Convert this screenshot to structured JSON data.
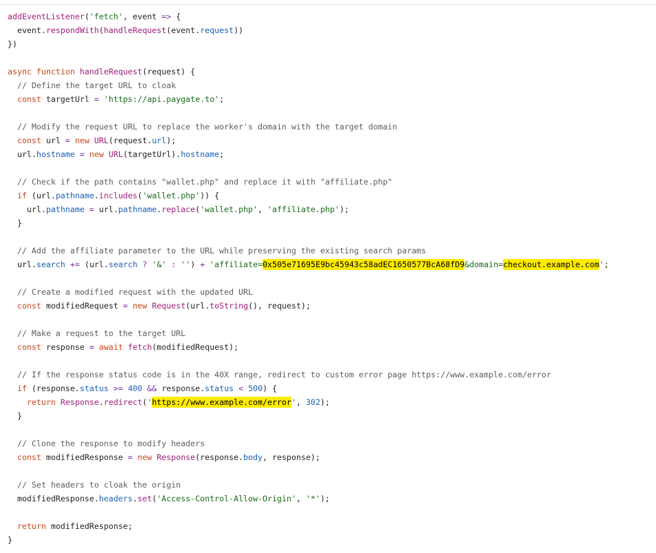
{
  "code_lines": [
    [
      {
        "t": "addEventListener",
        "c": "fn"
      },
      {
        "t": "("
      },
      {
        "t": "'fetch'",
        "c": "str"
      },
      {
        "t": ", event "
      },
      {
        "t": "=>",
        "c": "op"
      },
      {
        "t": " {"
      }
    ],
    [
      {
        "t": "  event."
      },
      {
        "t": "respondWith",
        "c": "fn"
      },
      {
        "t": "("
      },
      {
        "t": "handleRequest",
        "c": "fn"
      },
      {
        "t": "(event."
      },
      {
        "t": "request",
        "c": "prop"
      },
      {
        "t": "))"
      }
    ],
    [
      {
        "t": "})"
      }
    ],
    [],
    [
      {
        "t": "async ",
        "c": "kw"
      },
      {
        "t": "function ",
        "c": "kw"
      },
      {
        "t": "handleRequest",
        "c": "fn"
      },
      {
        "t": "(request) {"
      }
    ],
    [
      {
        "t": "  "
      },
      {
        "t": "// Define the target URL to cloak",
        "c": "cm"
      }
    ],
    [
      {
        "t": "  "
      },
      {
        "t": "const ",
        "c": "kw"
      },
      {
        "t": "targetUrl "
      },
      {
        "t": "=",
        "c": "op"
      },
      {
        "t": " "
      },
      {
        "t": "'https://api.paygate.to'",
        "c": "str"
      },
      {
        "t": ";"
      }
    ],
    [],
    [
      {
        "t": "  "
      },
      {
        "t": "// Modify the request URL to replace the worker's domain with the target domain",
        "c": "cm"
      }
    ],
    [
      {
        "t": "  "
      },
      {
        "t": "const ",
        "c": "kw"
      },
      {
        "t": "url "
      },
      {
        "t": "=",
        "c": "op"
      },
      {
        "t": " "
      },
      {
        "t": "new ",
        "c": "kw"
      },
      {
        "t": "URL",
        "c": "fn"
      },
      {
        "t": "(request."
      },
      {
        "t": "url",
        "c": "prop"
      },
      {
        "t": ");"
      }
    ],
    [
      {
        "t": "  url."
      },
      {
        "t": "hostname",
        "c": "prop"
      },
      {
        "t": " "
      },
      {
        "t": "=",
        "c": "op"
      },
      {
        "t": " "
      },
      {
        "t": "new ",
        "c": "kw"
      },
      {
        "t": "URL",
        "c": "fn"
      },
      {
        "t": "(targetUrl)."
      },
      {
        "t": "hostname",
        "c": "prop"
      },
      {
        "t": ";"
      }
    ],
    [],
    [
      {
        "t": "  "
      },
      {
        "t": "// Check if the path contains \"wallet.php\" and replace it with \"affiliate.php\"",
        "c": "cm"
      }
    ],
    [
      {
        "t": "  "
      },
      {
        "t": "if ",
        "c": "kw"
      },
      {
        "t": "(url."
      },
      {
        "t": "pathname",
        "c": "prop"
      },
      {
        "t": "."
      },
      {
        "t": "includes",
        "c": "fn"
      },
      {
        "t": "("
      },
      {
        "t": "'wallet.php'",
        "c": "str"
      },
      {
        "t": ")) {"
      }
    ],
    [
      {
        "t": "    url."
      },
      {
        "t": "pathname",
        "c": "prop"
      },
      {
        "t": " "
      },
      {
        "t": "=",
        "c": "op"
      },
      {
        "t": " url."
      },
      {
        "t": "pathname",
        "c": "prop"
      },
      {
        "t": "."
      },
      {
        "t": "replace",
        "c": "fn"
      },
      {
        "t": "("
      },
      {
        "t": "'wallet.php'",
        "c": "str"
      },
      {
        "t": ", "
      },
      {
        "t": "'affiliate.php'",
        "c": "str"
      },
      {
        "t": ");"
      }
    ],
    [
      {
        "t": "  }"
      }
    ],
    [],
    [
      {
        "t": "  "
      },
      {
        "t": "// Add the affiliate parameter to the URL while preserving the existing search params",
        "c": "cm"
      }
    ],
    [
      {
        "t": "  url."
      },
      {
        "t": "search",
        "c": "prop"
      },
      {
        "t": " "
      },
      {
        "t": "+=",
        "c": "op"
      },
      {
        "t": " (url."
      },
      {
        "t": "search",
        "c": "prop"
      },
      {
        "t": " "
      },
      {
        "t": "?",
        "c": "op"
      },
      {
        "t": " "
      },
      {
        "t": "'&'",
        "c": "str"
      },
      {
        "t": " "
      },
      {
        "t": ":",
        "c": "op"
      },
      {
        "t": " "
      },
      {
        "t": "''",
        "c": "str"
      },
      {
        "t": ") "
      },
      {
        "t": "+",
        "c": "op"
      },
      {
        "t": " "
      },
      {
        "t": "'affiliate=",
        "c": "str"
      },
      {
        "t": "0x505e71695E9bc45943c58adEC1650577BcA68fD9",
        "c": "hl"
      },
      {
        "t": "&domain=",
        "c": "str"
      },
      {
        "t": "checkout.example.com",
        "c": "hl"
      },
      {
        "t": "'",
        "c": "str"
      },
      {
        "t": ";"
      }
    ],
    [],
    [
      {
        "t": "  "
      },
      {
        "t": "// Create a modified request with the updated URL",
        "c": "cm"
      }
    ],
    [
      {
        "t": "  "
      },
      {
        "t": "const ",
        "c": "kw"
      },
      {
        "t": "modifiedRequest "
      },
      {
        "t": "=",
        "c": "op"
      },
      {
        "t": " "
      },
      {
        "t": "new ",
        "c": "kw"
      },
      {
        "t": "Request",
        "c": "fn"
      },
      {
        "t": "(url."
      },
      {
        "t": "toString",
        "c": "fn"
      },
      {
        "t": "(), request);"
      }
    ],
    [],
    [
      {
        "t": "  "
      },
      {
        "t": "// Make a request to the target URL",
        "c": "cm"
      }
    ],
    [
      {
        "t": "  "
      },
      {
        "t": "const ",
        "c": "kw"
      },
      {
        "t": "response "
      },
      {
        "t": "=",
        "c": "op"
      },
      {
        "t": " "
      },
      {
        "t": "await ",
        "c": "kw"
      },
      {
        "t": "fetch",
        "c": "fn"
      },
      {
        "t": "(modifiedRequest);"
      }
    ],
    [],
    [
      {
        "t": "  "
      },
      {
        "t": "// If the response status code is in the 40X range, redirect to custom error page https://www.example.com/error",
        "c": "cm"
      }
    ],
    [
      {
        "t": "  "
      },
      {
        "t": "if ",
        "c": "kw"
      },
      {
        "t": "(response."
      },
      {
        "t": "status",
        "c": "prop"
      },
      {
        "t": " "
      },
      {
        "t": ">=",
        "c": "op"
      },
      {
        "t": " "
      },
      {
        "t": "400",
        "c": "num"
      },
      {
        "t": " "
      },
      {
        "t": "&&",
        "c": "op"
      },
      {
        "t": " response."
      },
      {
        "t": "status",
        "c": "prop"
      },
      {
        "t": " "
      },
      {
        "t": "<",
        "c": "op"
      },
      {
        "t": " "
      },
      {
        "t": "500",
        "c": "num"
      },
      {
        "t": ") {"
      }
    ],
    [
      {
        "t": "    "
      },
      {
        "t": "return ",
        "c": "kw"
      },
      {
        "t": "Response",
        "c": "fn"
      },
      {
        "t": "."
      },
      {
        "t": "redirect",
        "c": "fn"
      },
      {
        "t": "("
      },
      {
        "t": "'",
        "c": "str"
      },
      {
        "t": "https://www.example.com/error",
        "c": "hl"
      },
      {
        "t": "'",
        "c": "str"
      },
      {
        "t": ", "
      },
      {
        "t": "302",
        "c": "num"
      },
      {
        "t": ");"
      }
    ],
    [
      {
        "t": "  }"
      }
    ],
    [],
    [
      {
        "t": "  "
      },
      {
        "t": "// Clone the response to modify headers",
        "c": "cm"
      }
    ],
    [
      {
        "t": "  "
      },
      {
        "t": "const ",
        "c": "kw"
      },
      {
        "t": "modifiedResponse "
      },
      {
        "t": "=",
        "c": "op"
      },
      {
        "t": " "
      },
      {
        "t": "new ",
        "c": "kw"
      },
      {
        "t": "Response",
        "c": "fn"
      },
      {
        "t": "(response."
      },
      {
        "t": "body",
        "c": "prop"
      },
      {
        "t": ", response);"
      }
    ],
    [],
    [
      {
        "t": "  "
      },
      {
        "t": "// Set headers to cloak the origin",
        "c": "cm"
      }
    ],
    [
      {
        "t": "  modifiedResponse."
      },
      {
        "t": "headers",
        "c": "prop"
      },
      {
        "t": "."
      },
      {
        "t": "set",
        "c": "fn"
      },
      {
        "t": "("
      },
      {
        "t": "'Access-Control-Allow-Origin'",
        "c": "str"
      },
      {
        "t": ", "
      },
      {
        "t": "'*'",
        "c": "str"
      },
      {
        "t": ");"
      }
    ],
    [],
    [
      {
        "t": "  "
      },
      {
        "t": "return ",
        "c": "kw"
      },
      {
        "t": "modifiedResponse;"
      }
    ],
    [
      {
        "t": "}"
      }
    ]
  ]
}
